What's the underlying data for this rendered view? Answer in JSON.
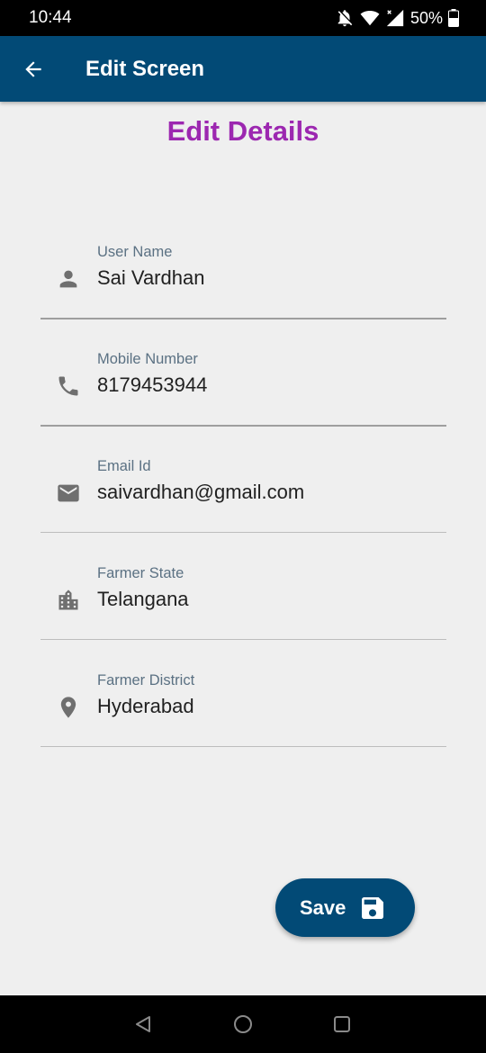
{
  "status_bar": {
    "time": "10:44",
    "battery": "50%",
    "icons": [
      "notifications-off-icon",
      "wifi-icon",
      "cell-signal-icon",
      "battery-icon"
    ]
  },
  "app_bar": {
    "title": "Edit Screen",
    "back_icon": "arrow-back-icon",
    "background": "#024a76"
  },
  "heading": {
    "text": "Edit Details",
    "color": "#9c27b0"
  },
  "fields": [
    {
      "label": "User Name",
      "value": "Sai Vardhan",
      "icon": "person-icon"
    },
    {
      "label": "Mobile Number",
      "value": "8179453944",
      "icon": "phone-icon"
    },
    {
      "label": "Email Id",
      "value": "saivardhan@gmail.com",
      "icon": "email-icon"
    },
    {
      "label": "Farmer State",
      "value": "Telangana",
      "icon": "city-icon"
    },
    {
      "label": "Farmer District",
      "value": "Hyderabad",
      "icon": "location-pin-icon"
    }
  ],
  "save_button": {
    "label": "Save",
    "icon": "save-icon"
  },
  "nav_bar": {
    "icons": [
      "nav-back-icon",
      "nav-home-icon",
      "nav-recents-icon"
    ]
  }
}
